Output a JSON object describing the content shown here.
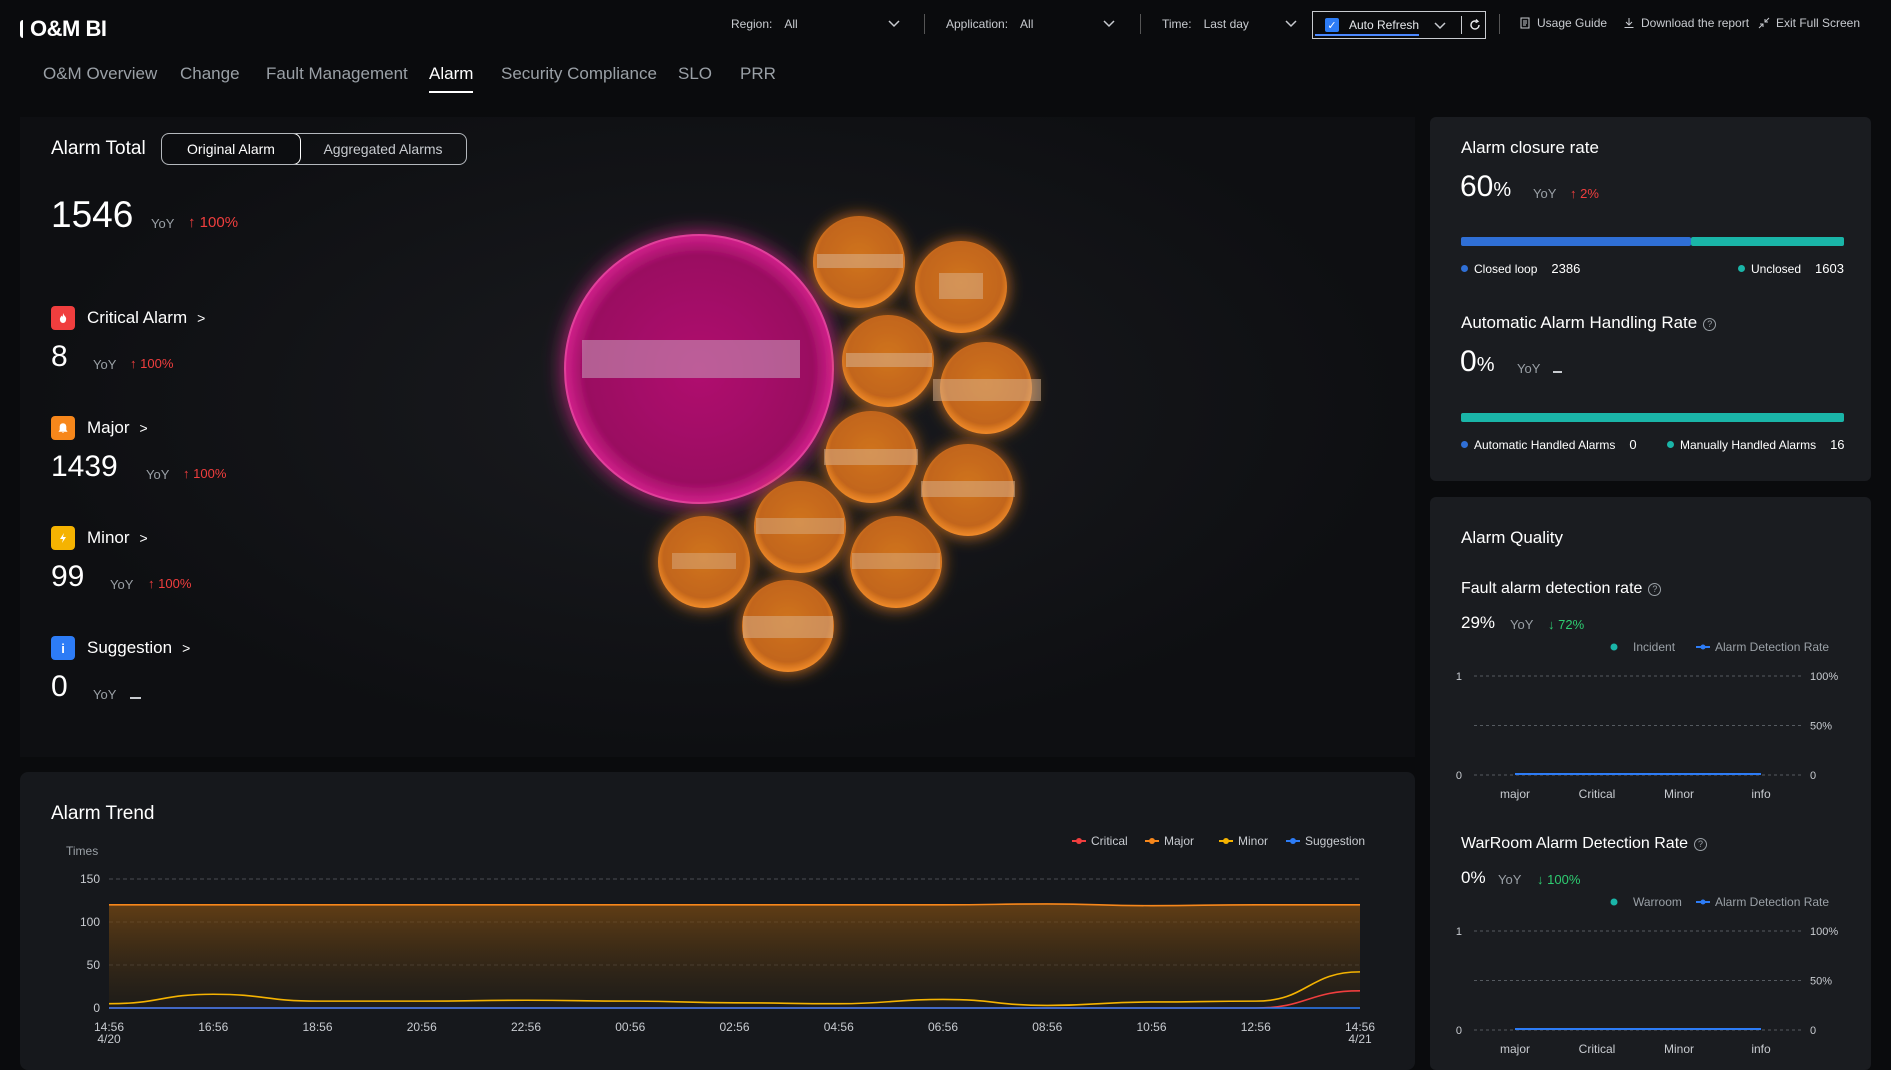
{
  "app": {
    "title": "O&M BI"
  },
  "filters": [
    {
      "label": "Region:",
      "value": "All"
    },
    {
      "label": "Application:",
      "value": "All"
    },
    {
      "label": "Time:",
      "value": "Last day"
    }
  ],
  "auto_refresh": {
    "label": "Auto Refresh",
    "checked": true
  },
  "toolbar": {
    "usage_guide": "Usage Guide",
    "download": "Download the report",
    "exit_full": "Exit Full Screen"
  },
  "tabs": [
    {
      "label": "O&M Overview",
      "active": false
    },
    {
      "label": "Change",
      "active": false
    },
    {
      "label": "Fault Management",
      "active": false
    },
    {
      "label": "Alarm",
      "active": true
    },
    {
      "label": "Security Compliance",
      "active": false
    },
    {
      "label": "SLO",
      "active": false
    },
    {
      "label": "PRR",
      "active": false
    }
  ],
  "alarm_total": {
    "title": "Alarm Total",
    "toggle": [
      "Original Alarm",
      "Aggregated Alarms"
    ],
    "selected": "Original Alarm",
    "value": "1546",
    "yoy_label": "YoY",
    "yoy_change": "100%"
  },
  "severities": [
    {
      "name": "Critical Alarm",
      "value": "8",
      "yoy_label": "YoY",
      "yoy_change": "100%",
      "color": "#f03e3e",
      "icon": "flame-icon"
    },
    {
      "name": "Major",
      "value": "1439",
      "yoy_label": "YoY",
      "yoy_change": "100%",
      "color": "#f7871b",
      "icon": "bell-icon"
    },
    {
      "name": "Minor",
      "value": "99",
      "yoy_label": "YoY",
      "yoy_change": "100%",
      "color": "#f5b301",
      "icon": "bolt-icon"
    },
    {
      "name": "Suggestion",
      "value": "0",
      "yoy_label": "YoY",
      "yoy_change": "",
      "color": "#2d7cf6",
      "icon": "info-icon"
    }
  ],
  "closure": {
    "title": "Alarm closure rate",
    "value": "60",
    "unit": "%",
    "yoy_label": "YoY",
    "yoy_change": "2%",
    "closed_label": "Closed loop",
    "closed_value": "2386",
    "unclosed_label": "Unclosed",
    "unclosed_value": "1603",
    "closed_fraction": 0.6,
    "closed_color": "#2f6fd6",
    "unclosed_color": "#1ab5a8"
  },
  "auto_handling": {
    "title": "Automatic Alarm Handling Rate",
    "value": "0",
    "unit": "%",
    "yoy_label": "YoY",
    "auto_label": "Automatic Handled Alarms",
    "auto_value": "0",
    "manual_label": "Manually Handled Alarms",
    "manual_value": "16",
    "auto_fraction": 0
  },
  "quality": {
    "title": "Alarm Quality",
    "fault": {
      "title": "Fault alarm detection rate",
      "value": "29",
      "unit": "%",
      "yoy_label": "YoY",
      "yoy_change": "72%",
      "legend": [
        "Incident",
        "Alarm Detection Rate"
      ]
    },
    "warroom": {
      "title": "WarRoom Alarm Detection Rate",
      "value": "0",
      "unit": "%",
      "yoy_label": "YoY",
      "yoy_change": "100%",
      "legend": [
        "Warroom",
        "Alarm Detection Rate"
      ]
    }
  },
  "trend_title": "Alarm Trend",
  "chart_data": [
    {
      "type": "area",
      "title": "Alarm Trend",
      "ylabel": "Times",
      "ylim": [
        0,
        150
      ],
      "yticks": [
        0,
        50,
        100,
        150
      ],
      "grid": true,
      "legend_position": "top-right",
      "x_ticks": [
        "14:56 4/20",
        "16:56",
        "18:56",
        "20:56",
        "22:56",
        "00:56",
        "02:56",
        "04:56",
        "06:56",
        "08:56",
        "10:56",
        "12:56",
        "14:56 4/21"
      ],
      "series": [
        {
          "name": "Critical",
          "color": "#f03e3e",
          "values": [
            0,
            0,
            0,
            0,
            0,
            0,
            0,
            0,
            0,
            0,
            0,
            0,
            20
          ]
        },
        {
          "name": "Major",
          "color": "#f7871b",
          "values": [
            120,
            120,
            120,
            120,
            120,
            120,
            120,
            120,
            120,
            121,
            119,
            120,
            120
          ]
        },
        {
          "name": "Minor",
          "color": "#f5b301",
          "values": [
            5,
            16,
            8,
            8,
            9,
            8,
            6,
            5,
            10,
            3,
            7,
            8,
            42
          ]
        },
        {
          "name": "Suggestion",
          "color": "#2d7cf6",
          "values": [
            0,
            0,
            0,
            0,
            0,
            0,
            0,
            0,
            0,
            0,
            0,
            0,
            0
          ]
        }
      ]
    },
    {
      "type": "line",
      "title": "Fault alarm detection rate",
      "categories": [
        "major",
        "Critical",
        "Minor",
        "info"
      ],
      "left_ticks": [
        "0",
        "1"
      ],
      "right_ticks": [
        "0",
        "50%",
        "100%"
      ],
      "series": [
        {
          "name": "Incident",
          "color": "#1ab5a8",
          "values": [
            0,
            0,
            0,
            0
          ]
        },
        {
          "name": "Alarm Detection Rate",
          "color": "#2d7cf6",
          "values": [
            0,
            0,
            0,
            0
          ]
        }
      ]
    },
    {
      "type": "line",
      "title": "WarRoom Alarm Detection Rate",
      "categories": [
        "major",
        "Critical",
        "Minor",
        "info"
      ],
      "left_ticks": [
        "0",
        "1"
      ],
      "right_ticks": [
        "0",
        "50%",
        "100%"
      ],
      "series": [
        {
          "name": "Warroom",
          "color": "#1ab5a8",
          "values": [
            0,
            0,
            0,
            0
          ]
        },
        {
          "name": "Alarm Detection Rate",
          "color": "#2d7cf6",
          "values": [
            0,
            0,
            0,
            0
          ]
        }
      ]
    }
  ]
}
